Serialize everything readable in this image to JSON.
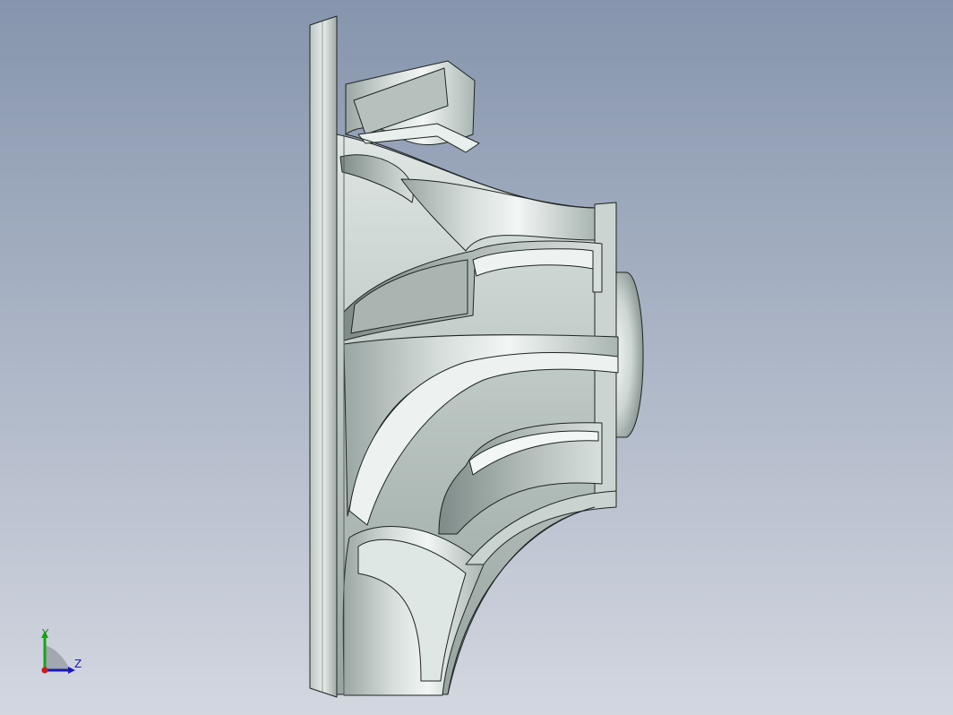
{
  "viewport": {
    "background_top": "#8797ae",
    "background_bottom": "#d4d8e1",
    "model_color": "#c4ceca",
    "edge_color": "#1e2422"
  },
  "triad": {
    "y_label": "Y",
    "z_label": "Z",
    "y_color": "#1aa21a",
    "z_color": "#1a1ab4",
    "x_color": "#cc1a1a"
  }
}
